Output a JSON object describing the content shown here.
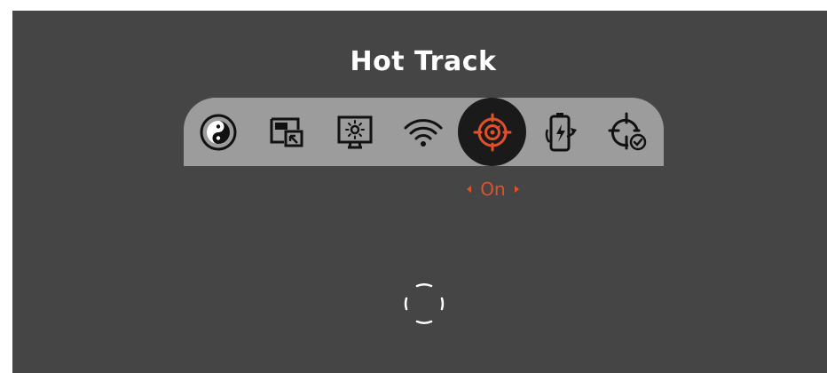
{
  "screen": {
    "title": "Hot Track",
    "background_color": "#454545",
    "accent_color": "#e2502a"
  },
  "menu": {
    "items": [
      {
        "icon": "color-palette-icon",
        "selected": false
      },
      {
        "icon": "picture-in-picture-icon",
        "selected": false
      },
      {
        "icon": "brightness-icon",
        "selected": false
      },
      {
        "icon": "wifi-icon",
        "selected": false
      },
      {
        "icon": "hot-track-target-icon",
        "selected": true
      },
      {
        "icon": "battery-charging-icon",
        "selected": false
      },
      {
        "icon": "crosshair-check-icon",
        "selected": false
      }
    ]
  },
  "setting": {
    "value": "On"
  },
  "viewfinder": {
    "icon": "center-reticle-icon"
  }
}
